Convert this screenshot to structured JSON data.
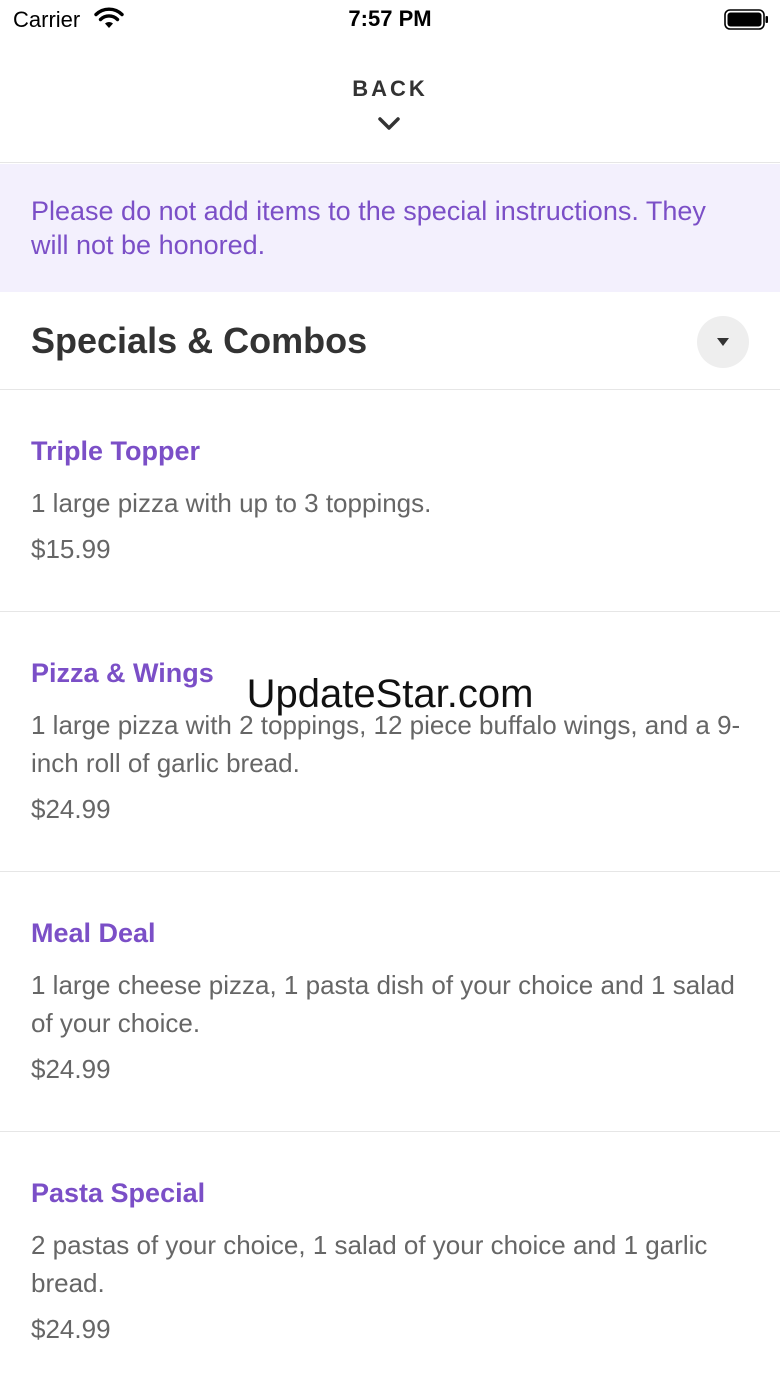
{
  "status_bar": {
    "carrier": "Carrier",
    "time": "7:57 PM"
  },
  "header": {
    "back_label": "BACK"
  },
  "notice": {
    "text": "Please do not add items to the special instructions. They will not be honored."
  },
  "section": {
    "title": "Specials & Combos"
  },
  "items": [
    {
      "name": "Triple Topper",
      "description": "1 large pizza with up to 3 toppings.",
      "price": "$15.99"
    },
    {
      "name": "Pizza & Wings",
      "description": "1 large pizza with 2 toppings, 12 piece buffalo wings, and a 9-inch roll of garlic bread.",
      "price": "$24.99"
    },
    {
      "name": "Meal Deal",
      "description": "1 large cheese pizza, 1 pasta dish of your choice and 1 salad of your choice.",
      "price": "$24.99"
    },
    {
      "name": "Pasta Special",
      "description": "2 pastas of your choice, 1 salad of your choice and 1 garlic bread.",
      "price": "$24.99"
    }
  ],
  "watermark": "UpdateStar.com",
  "colors": {
    "accent": "#7b4fc7",
    "notice_bg": "#f3f0fd",
    "text": "#333333",
    "muted": "#666666"
  },
  "icons": [
    "wifi-icon",
    "battery-icon",
    "chevron-down-icon",
    "caret-down-icon"
  ]
}
